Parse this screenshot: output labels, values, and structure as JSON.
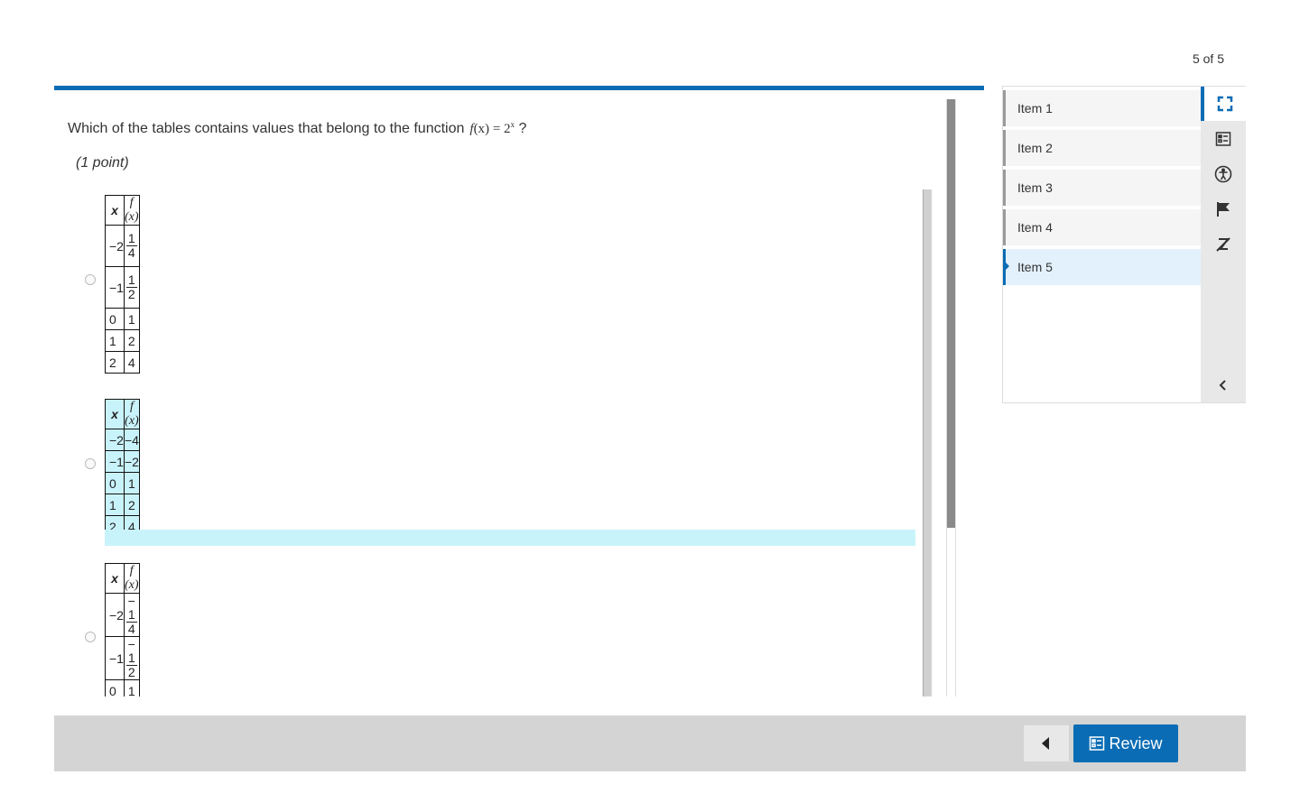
{
  "counter": "5 of 5",
  "question": {
    "text": "Which of the tables contains values that belong to the function",
    "math_lhs": "f",
    "math_arg": "(x)",
    "math_eq": " = 2",
    "math_exp": "x",
    "tail": " ?",
    "points": "(1 point)"
  },
  "options": [
    {
      "selected": false,
      "header": [
        "x",
        "f (x)"
      ],
      "rows": [
        {
          "x": "−2",
          "sign": "",
          "num": "1",
          "den": "4"
        },
        {
          "x": "−1",
          "sign": "",
          "num": "1",
          "den": "2"
        },
        {
          "x": "0",
          "fx": "1"
        },
        {
          "x": "1",
          "fx": "2"
        },
        {
          "x": "2",
          "fx": "4"
        }
      ]
    },
    {
      "selected": true,
      "header": [
        "x",
        "f (x)"
      ],
      "rows": [
        {
          "x": "−2",
          "fx": "−4"
        },
        {
          "x": "−1",
          "fx": "−2"
        },
        {
          "x": "0",
          "fx": "1"
        },
        {
          "x": "1",
          "fx": "2"
        },
        {
          "x": "2",
          "fx": "4"
        }
      ]
    },
    {
      "selected": false,
      "header": [
        "x",
        "f (x)"
      ],
      "rows": [
        {
          "x": "−2",
          "sign": "−",
          "num": "1",
          "den": "4"
        },
        {
          "x": "−1",
          "sign": "−",
          "num": "1",
          "den": "2"
        },
        {
          "x": "0",
          "fx": "1"
        },
        {
          "x": "",
          "fx": ""
        }
      ]
    }
  ],
  "nav": {
    "items": [
      {
        "label": "Item 1",
        "active": false
      },
      {
        "label": "Item 2",
        "active": false
      },
      {
        "label": "Item 3",
        "active": false
      },
      {
        "label": "Item 4",
        "active": false
      },
      {
        "label": "Item 5",
        "active": true
      }
    ],
    "tools": [
      "fullscreen-icon",
      "review-list-icon",
      "accessibility-icon",
      "flag-icon",
      "eliminator-icon"
    ]
  },
  "footer": {
    "review_label": "Review"
  },
  "colors": {
    "accent": "#0a6cb5",
    "selection": "#c9f3fb"
  }
}
